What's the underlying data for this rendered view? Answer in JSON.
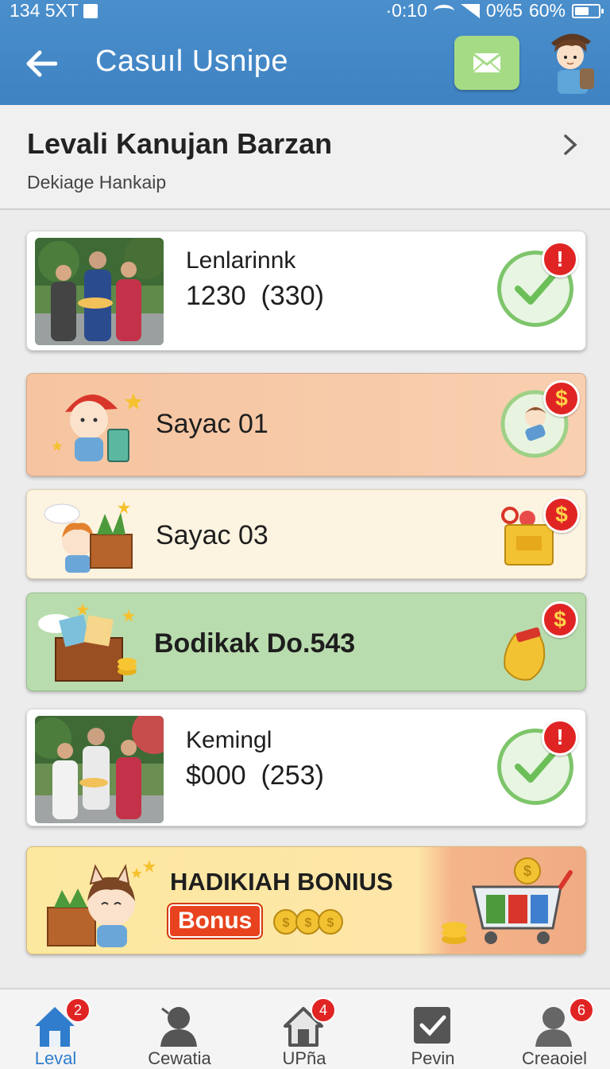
{
  "status_bar": {
    "left_text": "134 5XT",
    "time": "·0:10",
    "signal_text": "0%5",
    "battery": "60%",
    "battery_level": 0.6
  },
  "header": {
    "title": "Casuıl Usnipe",
    "back_icon": "arrow-left-icon",
    "mail_icon": "envelope-icon",
    "accent": "#4289c7"
  },
  "profile": {
    "name": "Levali Kanujan Barzan",
    "subtitle": "Dekiage Hankaip"
  },
  "cards": [
    {
      "kind": "photo",
      "title": "Lenlarinnk",
      "value": "1230",
      "sub_value": "(330)",
      "status_icon": "check-circle-icon",
      "badge": "!"
    },
    {
      "kind": "character",
      "title": "Sayac 01",
      "status_icon": "character-coin-icon",
      "badge": "$"
    },
    {
      "kind": "character",
      "title": "Sayac 03",
      "status_icon": "gift-bag-icon",
      "badge": "$"
    },
    {
      "kind": "treasure",
      "title": "Bodikak Do.543",
      "status_icon": "golden-pouch-icon",
      "badge": "$"
    },
    {
      "kind": "photo",
      "title": "Kemingl",
      "value": "$000",
      "sub_value": "(253)",
      "status_icon": "check-circle-icon",
      "badge": "!"
    }
  ],
  "bonus": {
    "title": "HADIKIAH BONIUS",
    "pill": "Bonus",
    "icon": "shopping-cart-icon"
  },
  "bottom_nav": [
    {
      "label": "Leval",
      "icon": "home-icon",
      "badge": "2",
      "active": true
    },
    {
      "label": "Cewatia",
      "icon": "person-icon",
      "badge": "",
      "active": false
    },
    {
      "label": "UPña",
      "icon": "house-outline-icon",
      "badge": "4",
      "active": false
    },
    {
      "label": "Pevin",
      "icon": "checkbox-icon",
      "badge": "",
      "active": false
    },
    {
      "label": "Creaoiel",
      "icon": "user-icon",
      "badge": "6",
      "active": false
    }
  ]
}
